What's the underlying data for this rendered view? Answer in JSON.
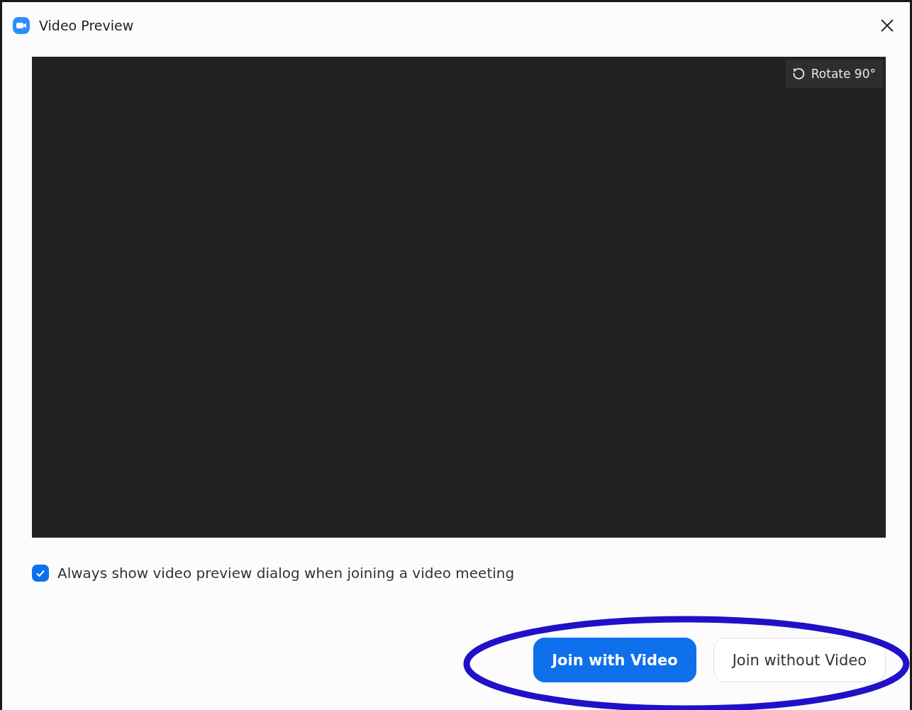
{
  "window": {
    "title": "Video Preview"
  },
  "preview": {
    "rotate_button": "Rotate 90°"
  },
  "option": {
    "label": "Always show video preview dialog when joining a video meeting",
    "checked": true
  },
  "buttons": [
    {
      "label": "Join with Video",
      "kind": "primary"
    },
    {
      "label": "Join without Video",
      "kind": "secondary"
    }
  ]
}
